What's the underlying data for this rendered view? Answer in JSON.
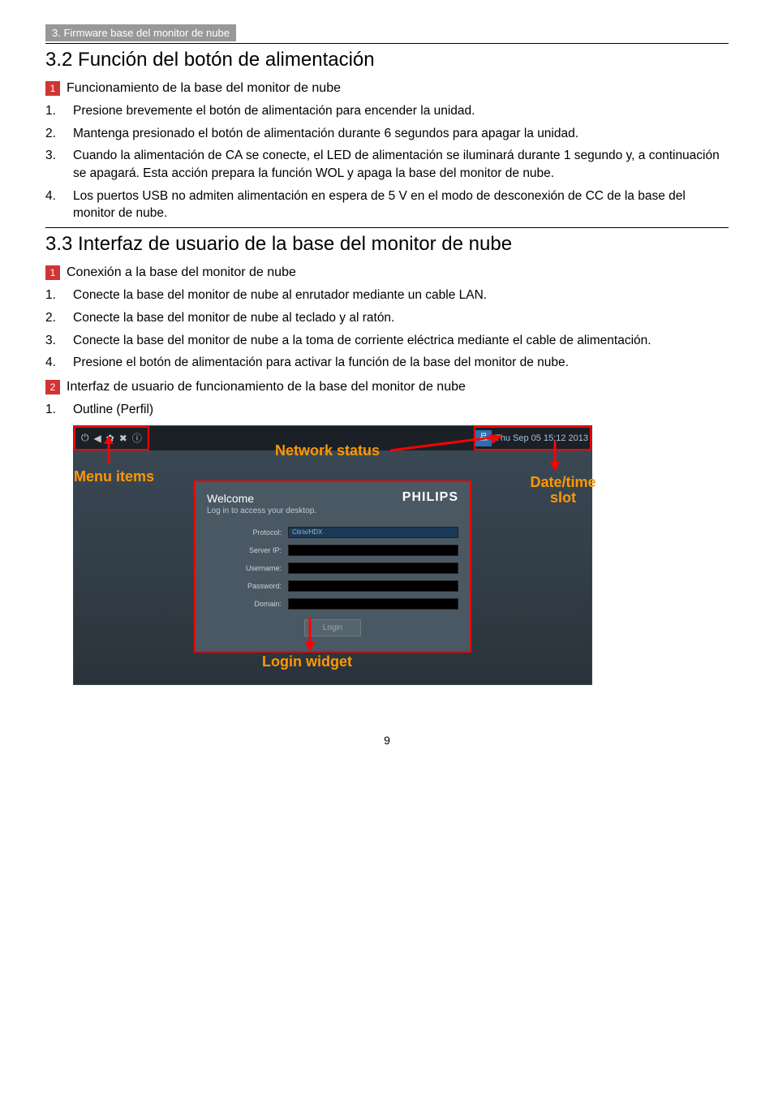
{
  "header": {
    "breadcrumb": "3. Firmware base del monitor de nube"
  },
  "section32": {
    "title": "3.2  Función del botón de alimentación",
    "sub1": "Funcionamiento de la base del monitor de nube",
    "items": [
      "Presione brevemente el botón de alimentación para encender la unidad.",
      "Mantenga presionado el botón de alimentación durante 6 segundos para apagar la unidad.",
      "Cuando la alimentación de CA se conecte, el LED de alimentación se iluminará durante 1 segundo y, a continuación se apagará. Esta acción prepara la función WOL y apaga la base del monitor de nube.",
      "Los puertos USB no admiten alimentación en espera de 5 V en el modo de desconexión de CC de la base del monitor de nube."
    ]
  },
  "section33": {
    "title": "3.3  Interfaz de usuario de la base del monitor de nube",
    "sub1": "Conexión a la base del monitor de nube",
    "items1": [
      "Conecte la base del monitor de nube al enrutador mediante un cable LAN.",
      "Conecte la base del monitor de nube al teclado y al ratón.",
      "Conecte la base del monitor de nube a la toma de corriente eléctrica mediante el cable de alimentación.",
      "Presione el botón de alimentación para activar la función de la base del monitor de nube."
    ],
    "sub2": "Interfaz de usuario de funcionamiento de la base del monitor de nube",
    "items2": [
      "Outline (Perfil)"
    ]
  },
  "figure": {
    "datetime": "Thu Sep 05 15:12 2013",
    "welcome": "Welcome",
    "sub": "Log in to access your desktop.",
    "brand": "PHILIPS",
    "fields": {
      "protocol_label": "Protocol:",
      "protocol_value": "Citrix/HDX",
      "server_label": "Server IP:",
      "username_label": "Username:",
      "password_label": "Password:",
      "domain_label": "Domain:"
    },
    "login_btn": "Login",
    "callouts": {
      "menu": "Menu items",
      "network": "Network status",
      "datetime": "Date/time slot",
      "login": "Login widget"
    }
  },
  "page_number": "9"
}
